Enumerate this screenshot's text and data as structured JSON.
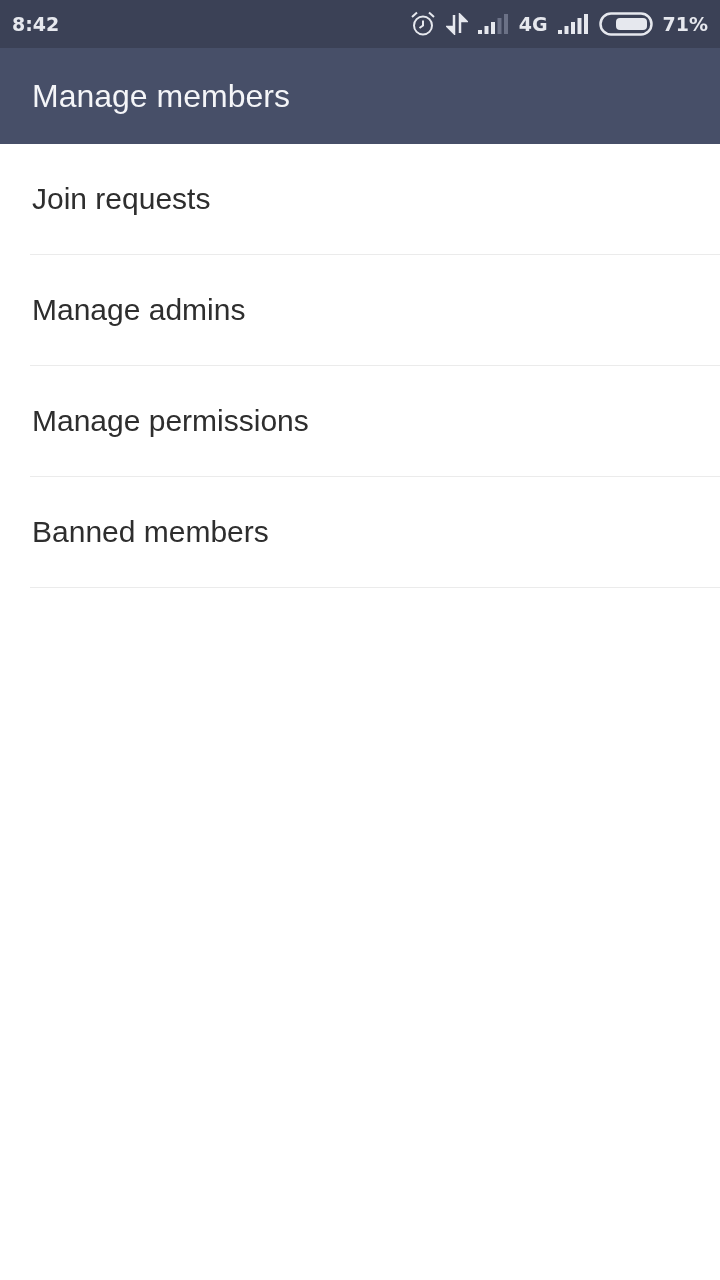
{
  "status_bar": {
    "time": "8:42",
    "network": "4G",
    "battery": "71%"
  },
  "app_bar": {
    "title": "Manage members"
  },
  "menu_items": [
    {
      "label": "Join requests"
    },
    {
      "label": "Manage admins"
    },
    {
      "label": "Manage permissions"
    },
    {
      "label": "Banned members"
    }
  ]
}
